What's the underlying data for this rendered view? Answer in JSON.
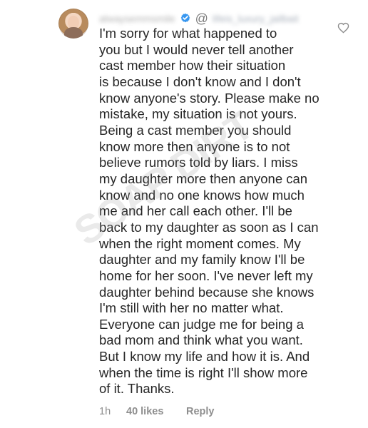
{
  "comment": {
    "avatar": "profile avatar",
    "username": "alwaysemmsmile",
    "mention": "@",
    "mentioned_handle": "lifeis_luxury_jailbait",
    "lines": [
      "I'm sorry for what happened to",
      "you but I would never tell another",
      "cast member how their situation",
      "is because I don't know and I don't",
      "know anyone's story. Please make no",
      "mistake, my situation is not yours.",
      "Being a cast member you should",
      "know more then anyone is to not",
      "believe rumors told by liars. I miss",
      "my daughter more then anyone can",
      "know and no one knows how much",
      "me and her call each other. I'll be",
      "back to my daughter as soon as I can",
      "when the right moment comes. My",
      "daughter and my family know I'll be",
      "home for her soon. I've never left my",
      "daughter behind because she knows",
      "I'm still with her no matter what.",
      "Everyone can judge me for being a",
      "bad mom and think what you want.",
      "But I know my life and how it is. And",
      "when the time is right I'll show more",
      "of it. Thanks."
    ],
    "time_ago": "1h",
    "likes": "40 likes",
    "reply_label": "Reply"
  },
  "watermark": {
    "text": "SOAP DIRT"
  },
  "icons": {
    "verified": "verified-badge-icon",
    "heart": "heart-outline-icon"
  },
  "colors": {
    "text": "#262626",
    "muted": "#8e8e8e",
    "verified": "#3897f0",
    "background": "#ffffff"
  }
}
